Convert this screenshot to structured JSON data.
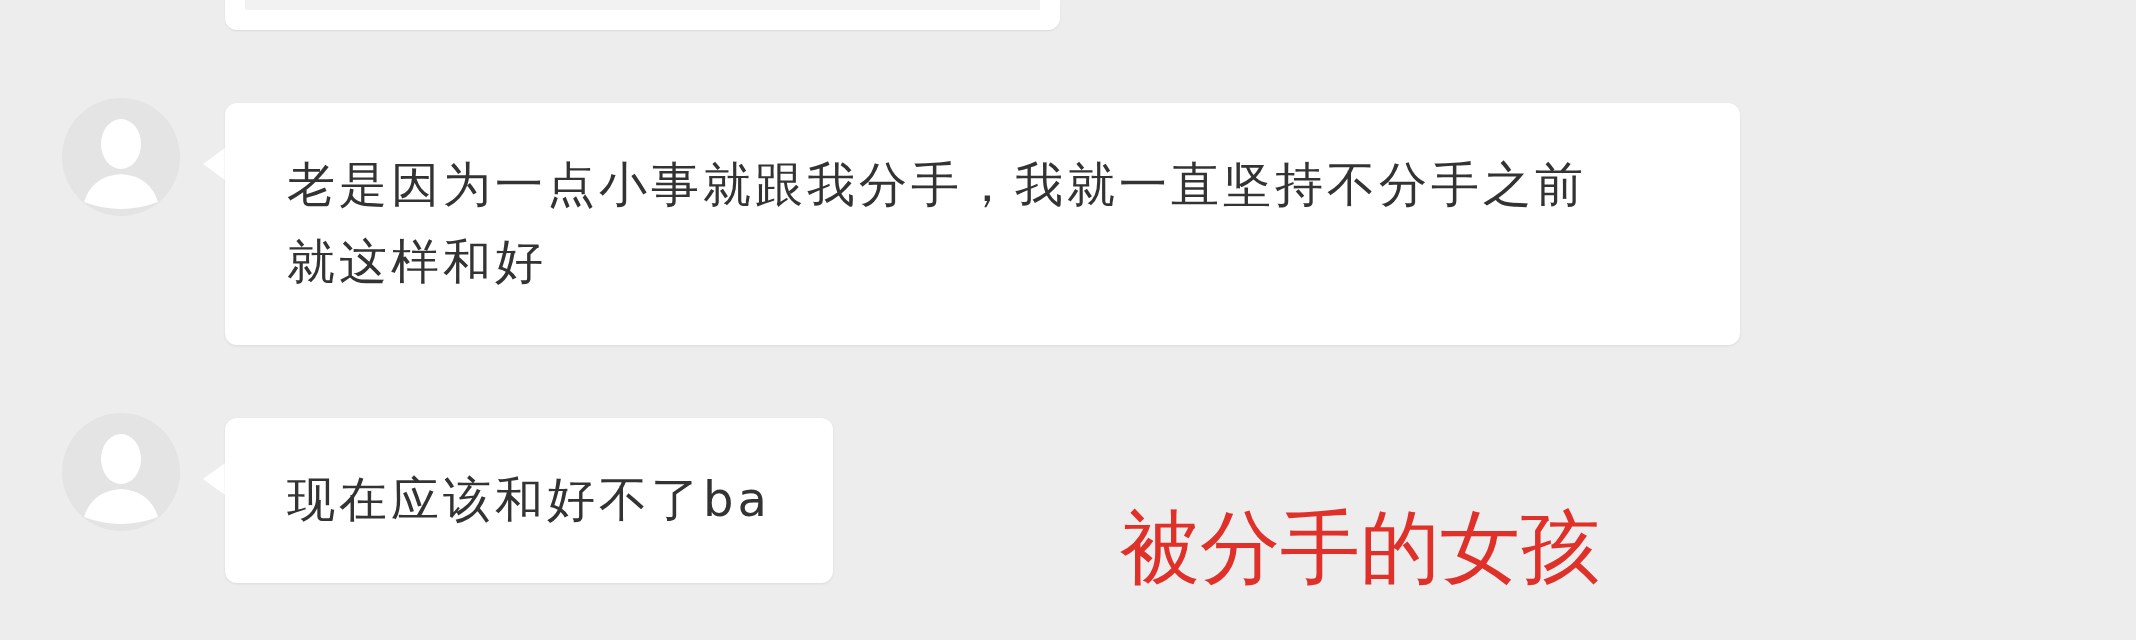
{
  "messages": [
    {
      "kind": "card"
    },
    {
      "kind": "text",
      "text": "老是因为一点小事就跟我分手，我就一直坚持不分手之前就这样和好"
    },
    {
      "kind": "text",
      "text": "现在应该和好不了ba"
    }
  ],
  "caption": {
    "text": "被分手的女孩",
    "color": "#e0302a"
  }
}
